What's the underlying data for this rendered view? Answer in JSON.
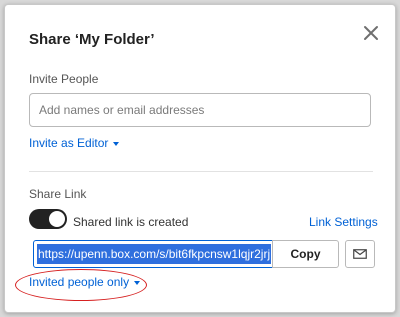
{
  "dialog": {
    "title": "Share ‘My Folder’",
    "close_icon": "close-icon"
  },
  "invite": {
    "section_label": "Invite People",
    "input_placeholder": "Add names or email addresses",
    "input_value": "",
    "permission_label": "Invite as Editor"
  },
  "share_link": {
    "section_label": "Share Link",
    "toggle_on": true,
    "toggle_label": "Shared link is created",
    "settings_label": "Link Settings",
    "url": "https://upenn.box.com/s/bit6fkpcnsw1lqjr2jrj",
    "copy_label": "Copy",
    "email_icon": "envelope-icon",
    "access_label": "Invited people only"
  },
  "colors": {
    "accent": "#0061d5",
    "selection": "#2f6fde",
    "annotation": "#d62020",
    "toggle_on": "#222222"
  }
}
